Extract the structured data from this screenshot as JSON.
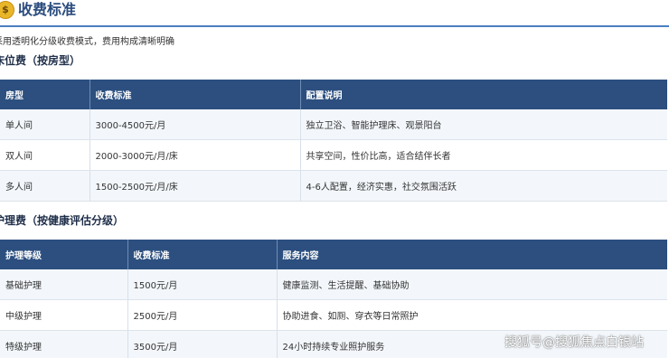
{
  "header": {
    "icon": "money-bag-icon",
    "icon_glyph": "$",
    "title": "收费标准"
  },
  "intro": "采用透明化分级收费模式，费用构成清晰明确",
  "bed_fee": {
    "title": "床位费（按房型）",
    "columns": [
      "房型",
      "收费标准",
      "配置说明"
    ],
    "rows": [
      {
        "type": "单人间",
        "price": "3000-4500元/月",
        "desc": "独立卫浴、智能护理床、观景阳台"
      },
      {
        "type": "双人间",
        "price": "2000-3000元/月/床",
        "desc": "共享空间，性价比高，适合结伴长者"
      },
      {
        "type": "多人间",
        "price": "1500-2500元/月/床",
        "desc": "4-6人配置，经济实惠，社交氛围活跃"
      }
    ]
  },
  "care_fee": {
    "title": "护理费（按健康评估分级）",
    "columns": [
      "护理等级",
      "收费标准",
      "服务内容"
    ],
    "rows": [
      {
        "level": "基础护理",
        "price": "1500元/月",
        "desc": "健康监测、生活提醒、基础协助"
      },
      {
        "level": "中级护理",
        "price": "2500元/月",
        "desc": "协助进食、如厕、穿衣等日常照护"
      },
      {
        "level": "特级护理",
        "price": "3500元/月",
        "desc": "24小时持续专业照护服务"
      }
    ]
  },
  "watermark": "搜狐号@搜狐焦点白银站",
  "colors": {
    "header_bg": "#2c4f7f",
    "accent": "#4a7fc1",
    "row_alt": "#f3f7fb"
  }
}
